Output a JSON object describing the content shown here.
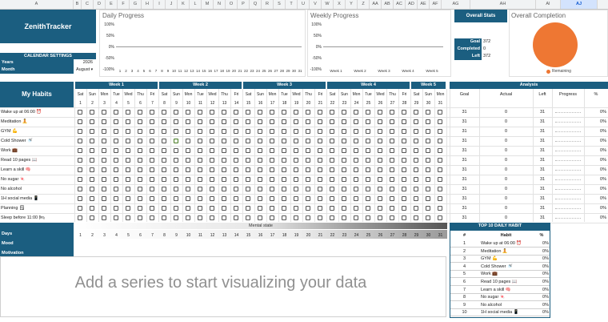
{
  "columns": [
    "A",
    "B",
    "C",
    "D",
    "E",
    "F",
    "G",
    "H",
    "I",
    "J",
    "K",
    "L",
    "M",
    "N",
    "O",
    "P",
    "Q",
    "R",
    "S",
    "T",
    "U",
    "V",
    "W",
    "X",
    "Y",
    "Z",
    "AA",
    "AB",
    "AC",
    "AD",
    "AE",
    "AF",
    "AG",
    "AH",
    "AI",
    "AJ",
    "AK"
  ],
  "selected_column": "AJ",
  "app": {
    "title": "ZenithTracker"
  },
  "calendar": {
    "title": "CALENDAR SETTINGS",
    "years_label": "Years",
    "year_value": "2026",
    "month_label": "Month",
    "month_value": "August"
  },
  "daily_chart": {
    "title": "Daily Progress",
    "y_ticks": [
      "100%",
      "50%",
      "0%",
      "-50%",
      "-100%"
    ],
    "x_ticks": [
      "1",
      "2",
      "3",
      "4",
      "5",
      "6",
      "7",
      "8",
      "9",
      "10",
      "11",
      "12",
      "13",
      "14",
      "15",
      "16",
      "17",
      "18",
      "19",
      "20",
      "21",
      "22",
      "23",
      "24",
      "25",
      "26",
      "27",
      "28",
      "29",
      "30",
      "31"
    ]
  },
  "weekly_chart": {
    "title": "Weekly Progress",
    "y_ticks": [
      "100%",
      "50%",
      "0%",
      "-50%",
      "-100%"
    ],
    "x_ticks": [
      "Week 1",
      "Week 2",
      "Week 3",
      "Week 4",
      "Week 5"
    ]
  },
  "overall_stats": {
    "title": "Overall Stats",
    "goal_label": "Goal",
    "goal_value": "372",
    "completed_label": "Completed",
    "completed_value": "0",
    "left_label": "Left",
    "left_value": "372"
  },
  "overall_completion": {
    "title": "Overall Completion",
    "legend": "Remaining",
    "color": "#ee7733"
  },
  "habits_title": "My Habits",
  "weeks": [
    "Week 1",
    "Week 2",
    "Week 3",
    "Week 4",
    "Week 5"
  ],
  "day_names": [
    "Sat",
    "Sun",
    "Mon",
    "Tue",
    "Wed",
    "Thu",
    "Fri",
    "Sat",
    "Sun",
    "Mon",
    "Tue",
    "Wed",
    "Thu",
    "Fri",
    "Sat",
    "Sun",
    "Mon",
    "Tue",
    "Wed",
    "Thu",
    "Fri",
    "Sat",
    "Sun",
    "Mon",
    "Tue",
    "Wed",
    "Thu",
    "Fri",
    "Sat",
    "Sun",
    "Mon"
  ],
  "day_numbers": [
    "1",
    "2",
    "3",
    "4",
    "5",
    "6",
    "7",
    "8",
    "9",
    "10",
    "11",
    "12",
    "13",
    "14",
    "15",
    "16",
    "17",
    "18",
    "19",
    "20",
    "21",
    "22",
    "23",
    "24",
    "25",
    "26",
    "27",
    "28",
    "29",
    "30",
    "31"
  ],
  "analysis": {
    "title": "Analysis",
    "headers": [
      "Goal",
      "Actual",
      "Left",
      "Progress",
      "%"
    ]
  },
  "habits": [
    {
      "name": "Wake up at 06:00 ⏰",
      "goal": "31",
      "actual": "0",
      "left": "31",
      "pct": "0%"
    },
    {
      "name": "Meditation 🧘",
      "goal": "31",
      "actual": "0",
      "left": "31",
      "pct": "0%"
    },
    {
      "name": "GYM 💪",
      "goal": "31",
      "actual": "0",
      "left": "31",
      "pct": "0%"
    },
    {
      "name": "Cold Shower 🚿",
      "goal": "31",
      "actual": "0",
      "left": "31",
      "pct": "0%"
    },
    {
      "name": "Work 💼",
      "goal": "31",
      "actual": "0",
      "left": "31",
      "pct": "0%"
    },
    {
      "name": "Read 10 pages 📖",
      "goal": "31",
      "actual": "0",
      "left": "31",
      "pct": "0%"
    },
    {
      "name": "Learn a skill 🧠",
      "goal": "31",
      "actual": "0",
      "left": "31",
      "pct": "0%"
    },
    {
      "name": "No sugar 🍬",
      "goal": "31",
      "actual": "0",
      "left": "31",
      "pct": "0%"
    },
    {
      "name": "No alcohol",
      "goal": "31",
      "actual": "0",
      "left": "31",
      "pct": "0%"
    },
    {
      "name": "1H social media 📱",
      "goal": "31",
      "actual": "0",
      "left": "31",
      "pct": "0%"
    },
    {
      "name": "Planning 🗒",
      "goal": "31",
      "actual": "0",
      "left": "31",
      "pct": "0%"
    },
    {
      "name": "Sleep before 11:00 🛏",
      "goal": "31",
      "actual": "0",
      "left": "31",
      "pct": "0%"
    }
  ],
  "mental": {
    "title": "Mental state",
    "days_label": "Days",
    "mood_label": "Mood",
    "motivation_label": "Motivation"
  },
  "empty_chart": {
    "message": "Add a series to start visualizing your data"
  },
  "top10": {
    "title": "TOP 10 DAILY HABIT",
    "headers": [
      "#",
      "Habit",
      "%"
    ],
    "rows": [
      {
        "rank": "1",
        "habit": "Wake up at 06:00 ⏰",
        "pct": "0%"
      },
      {
        "rank": "2",
        "habit": "Meditation 🧘",
        "pct": "0%"
      },
      {
        "rank": "3",
        "habit": "GYM 💪",
        "pct": "0%"
      },
      {
        "rank": "4",
        "habit": "Cold Shower 🚿",
        "pct": "0%"
      },
      {
        "rank": "5",
        "habit": "Work 💼",
        "pct": "0%"
      },
      {
        "rank": "6",
        "habit": "Read 10 pages 📖",
        "pct": "0%"
      },
      {
        "rank": "7",
        "habit": "Learn a skill 🧠",
        "pct": "0%"
      },
      {
        "rank": "8",
        "habit": "No sugar 🍬",
        "pct": "0%"
      },
      {
        "rank": "9",
        "habit": "No alcohol",
        "pct": "0%"
      },
      {
        "rank": "10",
        "habit": "1H social media 📱",
        "pct": "0%"
      }
    ]
  },
  "colors": {
    "navy": "#1b5e80",
    "orange": "#ee7733"
  }
}
